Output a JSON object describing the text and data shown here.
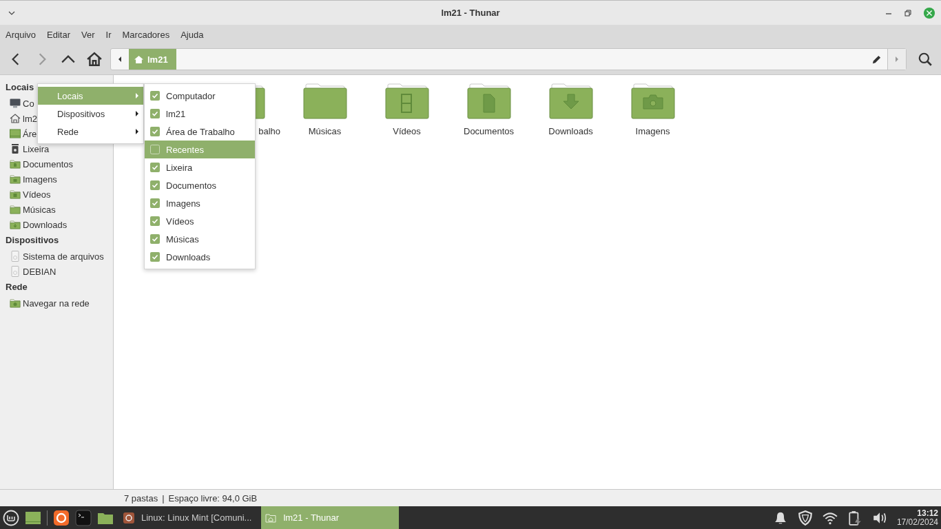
{
  "window": {
    "title": "lm21 - Thunar"
  },
  "menubar": [
    "Arquivo",
    "Editar",
    "Ver",
    "Ir",
    "Marcadores",
    "Ajuda"
  ],
  "toolbar": {
    "back_disabled": false,
    "forward_disabled": true,
    "path": [
      {
        "label": "lm21",
        "selected": true
      }
    ]
  },
  "sidebar": {
    "sections": [
      {
        "title": "Locais",
        "items": [
          {
            "label": "Co",
            "kind": "computer"
          },
          {
            "label": "lm2",
            "kind": "home"
          },
          {
            "label": "Áre",
            "kind": "desktop"
          },
          {
            "label": "Lixeira",
            "kind": "trash"
          },
          {
            "label": "Documentos",
            "kind": "folder-doc"
          },
          {
            "label": "Imagens",
            "kind": "folder-image"
          },
          {
            "label": "Vídeos",
            "kind": "folder-video"
          },
          {
            "label": "Músicas",
            "kind": "folder"
          },
          {
            "label": "Downloads",
            "kind": "folder-download"
          }
        ]
      },
      {
        "title": "Dispositivos",
        "items": [
          {
            "label": "Sistema de arquivos",
            "kind": "drive"
          },
          {
            "label": "DEBIAN",
            "kind": "drive"
          }
        ]
      },
      {
        "title": "Rede",
        "items": [
          {
            "label": "Navegar na rede",
            "kind": "folder-network"
          }
        ]
      }
    ]
  },
  "folders": [
    {
      "label": "balho",
      "kind": "folder",
      "cut_off": true
    },
    {
      "label": "Músicas",
      "kind": "folder",
      "cut_off": false
    },
    {
      "label": "Vídeos",
      "kind": "folder-video",
      "cut_off": false
    },
    {
      "label": "Documentos",
      "kind": "folder-doc",
      "cut_off": false
    },
    {
      "label": "Downloads",
      "kind": "folder-download",
      "cut_off": false
    },
    {
      "label": "Imagens",
      "kind": "folder-image",
      "cut_off": false
    }
  ],
  "context_menu": {
    "items": [
      {
        "label": "Locais",
        "selected": true
      },
      {
        "label": "Dispositivos",
        "selected": false
      },
      {
        "label": "Rede",
        "selected": false
      }
    ],
    "submenu": [
      {
        "label": "Computador",
        "checked": true,
        "selected": false
      },
      {
        "label": "lm21",
        "checked": true,
        "selected": false
      },
      {
        "label": "Área de Trabalho",
        "checked": true,
        "selected": false
      },
      {
        "label": "Recentes",
        "checked": false,
        "selected": true
      },
      {
        "label": "Lixeira",
        "checked": true,
        "selected": false
      },
      {
        "label": "Documentos",
        "checked": true,
        "selected": false
      },
      {
        "label": "Imagens",
        "checked": true,
        "selected": false
      },
      {
        "label": "Vídeos",
        "checked": true,
        "selected": false
      },
      {
        "label": "Músicas",
        "checked": true,
        "selected": false
      },
      {
        "label": "Downloads",
        "checked": true,
        "selected": false
      }
    ]
  },
  "status_bar": {
    "count": "7 pastas",
    "separator": "|",
    "free_space": "Espaço livre: 94,0 GiB"
  },
  "taskbar": {
    "windows": [
      {
        "label": "Linux: Linux Mint [Comuni...",
        "kind": "browser",
        "selected": false
      },
      {
        "label": "lm21 - Thunar",
        "kind": "files",
        "selected": true
      }
    ],
    "clock": {
      "time": "13:12",
      "date": "17/02/2024"
    }
  }
}
